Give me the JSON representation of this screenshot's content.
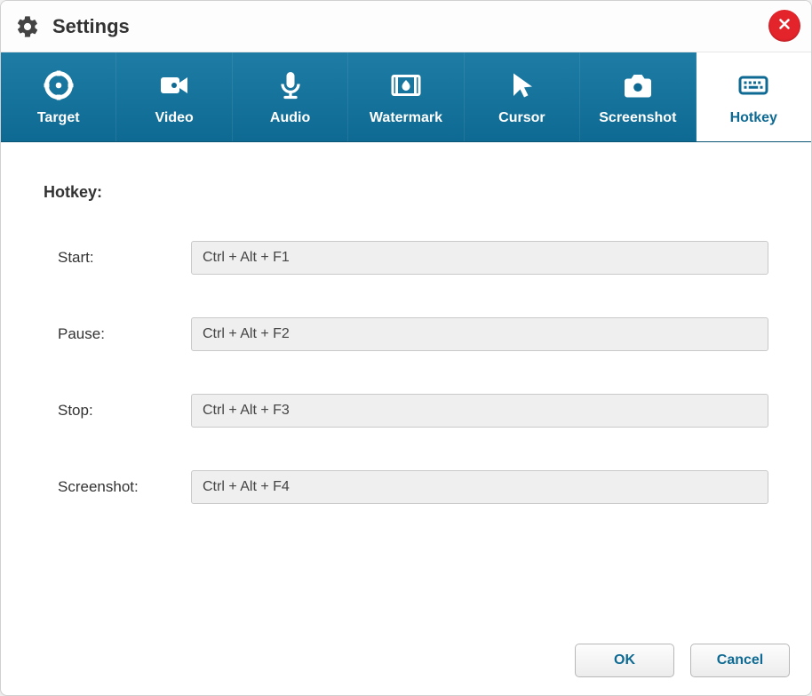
{
  "window": {
    "title": "Settings"
  },
  "tabs": [
    {
      "label": "Target"
    },
    {
      "label": "Video"
    },
    {
      "label": "Audio"
    },
    {
      "label": "Watermark"
    },
    {
      "label": "Cursor"
    },
    {
      "label": "Screenshot"
    },
    {
      "label": "Hotkey"
    }
  ],
  "hotkey": {
    "section_title": "Hotkey:",
    "rows": {
      "start": {
        "label": "Start:",
        "value": "Ctrl + Alt + F1"
      },
      "pause": {
        "label": "Pause:",
        "value": "Ctrl + Alt + F2"
      },
      "stop": {
        "label": "Stop:",
        "value": "Ctrl + Alt + F3"
      },
      "screenshot": {
        "label": "Screenshot:",
        "value": "Ctrl + Alt + F4"
      }
    }
  },
  "footer": {
    "ok": "OK",
    "cancel": "Cancel"
  }
}
